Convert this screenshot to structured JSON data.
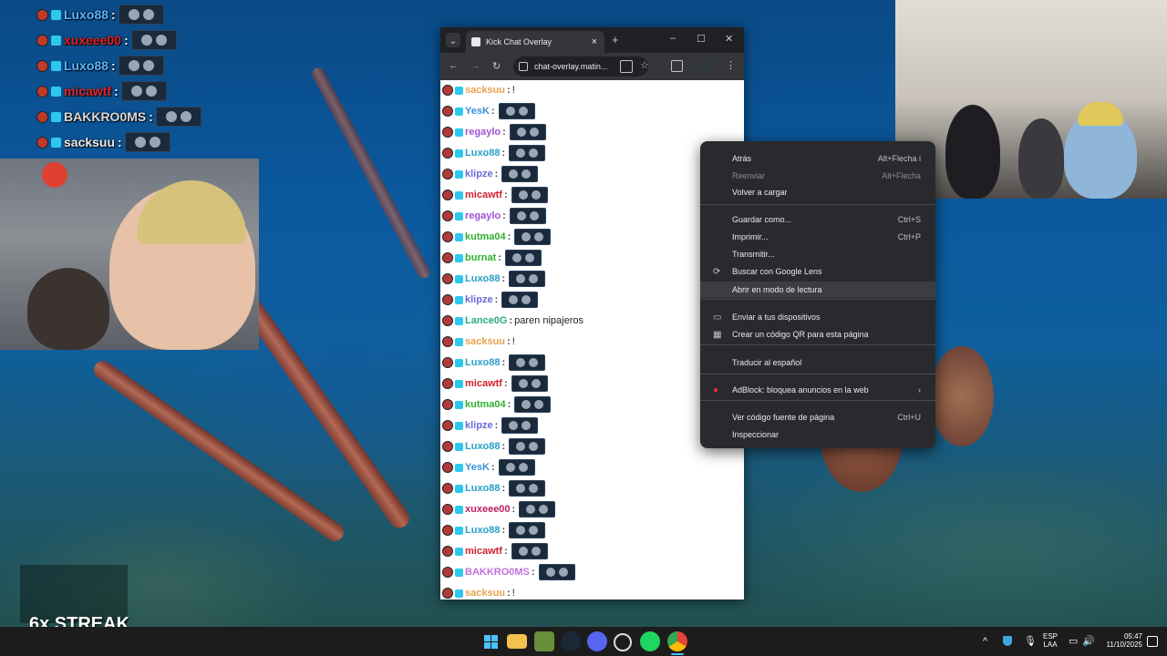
{
  "overlay_chat": [
    {
      "user": "Luxo88",
      "color": "#59b6ff"
    },
    {
      "user": "xuxeee00",
      "color": "#e02020"
    },
    {
      "user": "Luxo88",
      "color": "#59b6ff"
    },
    {
      "user": "micawtf",
      "color": "#e0252a"
    },
    {
      "user": "BAKKRO0MS",
      "color": "#d8d8d8"
    },
    {
      "user": "sacksuu",
      "color": "#eaeaea"
    }
  ],
  "streak": {
    "label": "6x STREAK"
  },
  "browser": {
    "tab_title": "Kick Chat Overlay",
    "new_tab": "+",
    "url": "chat-overlay.matin...",
    "buttons": {
      "minimize": "–",
      "maximize": "☐",
      "close": "✕",
      "back": "←",
      "forward": "→",
      "reload": "↻",
      "menu": "⋮",
      "tab_close": "×",
      "tab_search": "⌄"
    }
  },
  "chat_lines": [
    {
      "user": "sacksuu",
      "color": "#e8a050",
      "msg": "!"
    },
    {
      "user": "YesK",
      "color": "#3a8fd8",
      "msg": ""
    },
    {
      "user": "regaylo",
      "color": "#a050d0",
      "msg": ""
    },
    {
      "user": "Luxo88",
      "color": "#2aa0c8",
      "msg": ""
    },
    {
      "user": "klipze",
      "color": "#6a6adc",
      "msg": ""
    },
    {
      "user": "micawtf",
      "color": "#d02030",
      "msg": ""
    },
    {
      "user": "regaylo",
      "color": "#a050d0",
      "msg": ""
    },
    {
      "user": "kutma04",
      "color": "#30b030",
      "msg": ""
    },
    {
      "user": "burnat",
      "color": "#30b030",
      "msg": ""
    },
    {
      "user": "Luxo88",
      "color": "#2aa0c8",
      "msg": ""
    },
    {
      "user": "klipze",
      "color": "#6a6adc",
      "msg": ""
    },
    {
      "user": "Lance0G",
      "color": "#2ca88a",
      "msg": "paren nipajeros"
    },
    {
      "user": "sacksuu",
      "color": "#e8a050",
      "msg": "!"
    },
    {
      "user": "Luxo88",
      "color": "#2aa0c8",
      "msg": ""
    },
    {
      "user": "micawtf",
      "color": "#d02030",
      "msg": ""
    },
    {
      "user": "kutma04",
      "color": "#30b030",
      "msg": ""
    },
    {
      "user": "klipze",
      "color": "#6a6adc",
      "msg": ""
    },
    {
      "user": "Luxo88",
      "color": "#2aa0c8",
      "msg": ""
    },
    {
      "user": "YesK",
      "color": "#3a8fd8",
      "msg": ""
    },
    {
      "user": "Luxo88",
      "color": "#2aa0c8",
      "msg": ""
    },
    {
      "user": "xuxeee00",
      "color": "#c02060",
      "msg": ""
    },
    {
      "user": "Luxo88",
      "color": "#2aa0c8",
      "msg": ""
    },
    {
      "user": "micawtf",
      "color": "#d02030",
      "msg": ""
    },
    {
      "user": "BAKKRO0MS",
      "color": "#c070e0",
      "msg": ""
    },
    {
      "user": "sacksuu",
      "color": "#e8a050",
      "msg": "!"
    }
  ],
  "context_menu": {
    "items": [
      {
        "label": "Atrás",
        "shortcut": "Alt+Flecha i"
      },
      {
        "label": "Reenviar",
        "shortcut": "Alt+Flecha"
      },
      {
        "label": "Volver a cargar",
        "shortcut": ""
      },
      {
        "label": "Guardar como...",
        "shortcut": "Ctrl+S"
      },
      {
        "label": "Imprimir...",
        "shortcut": "Ctrl+P"
      },
      {
        "label": "Transmitir...",
        "shortcut": ""
      },
      {
        "label": "Buscar con Google Lens",
        "shortcut": ""
      },
      {
        "label": "Abrir en modo de lectura",
        "shortcut": ""
      },
      {
        "label": "Enviar a tus dispositivos",
        "shortcut": ""
      },
      {
        "label": "Crear un código QR para esta página",
        "shortcut": ""
      },
      {
        "label": "Traducir al español",
        "shortcut": ""
      },
      {
        "label": "AdBlock: bloquea anuncios en la web",
        "shortcut": "›"
      },
      {
        "label": "Ver código fuente de página",
        "shortcut": "Ctrl+U"
      },
      {
        "label": "Inspeccionar",
        "shortcut": ""
      }
    ]
  },
  "taskbar": {
    "lang": "ESP",
    "layout": "LAA",
    "time": "05:47",
    "date": "11/10/2025",
    "chevron": "^"
  }
}
